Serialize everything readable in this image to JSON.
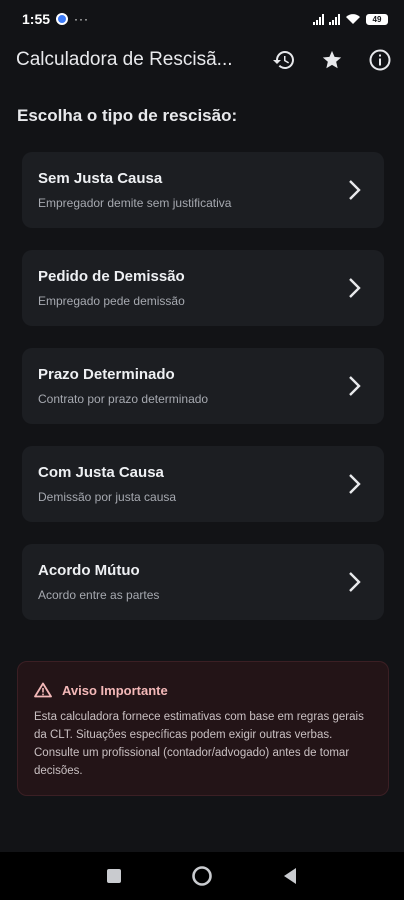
{
  "status_bar": {
    "time": "1:55",
    "more": "···",
    "battery": "49"
  },
  "app_bar": {
    "title": "Calculadora de Rescisã..."
  },
  "section_title": "Escolha o tipo de rescisão:",
  "options": [
    {
      "title": "Sem Justa Causa",
      "subtitle": "Empregador demite sem justificativa"
    },
    {
      "title": "Pedido de Demissão",
      "subtitle": "Empregado pede demissão"
    },
    {
      "title": "Prazo Determinado",
      "subtitle": "Contrato por prazo determinado"
    },
    {
      "title": "Com Justa Causa",
      "subtitle": "Demissão por justa causa"
    },
    {
      "title": "Acordo Mútuo",
      "subtitle": "Acordo entre as partes"
    }
  ],
  "warning": {
    "title": "Aviso Importante",
    "body": "Esta calculadora fornece estimativas com base em regras gerais da CLT. Situações específicas podem exigir outras verbas. Consulte um profissional (contador/advogado) antes de tomar decisões."
  },
  "icons": {
    "history": "history-icon",
    "favorite": "star-icon",
    "info": "info-icon",
    "chevron": "chevron-right-icon",
    "warning": "warning-triangle-icon"
  },
  "colors": {
    "background": "#121316",
    "card": "#1c1e22",
    "warning_bg": "#231417",
    "warning_accent": "#f3b8b8"
  }
}
